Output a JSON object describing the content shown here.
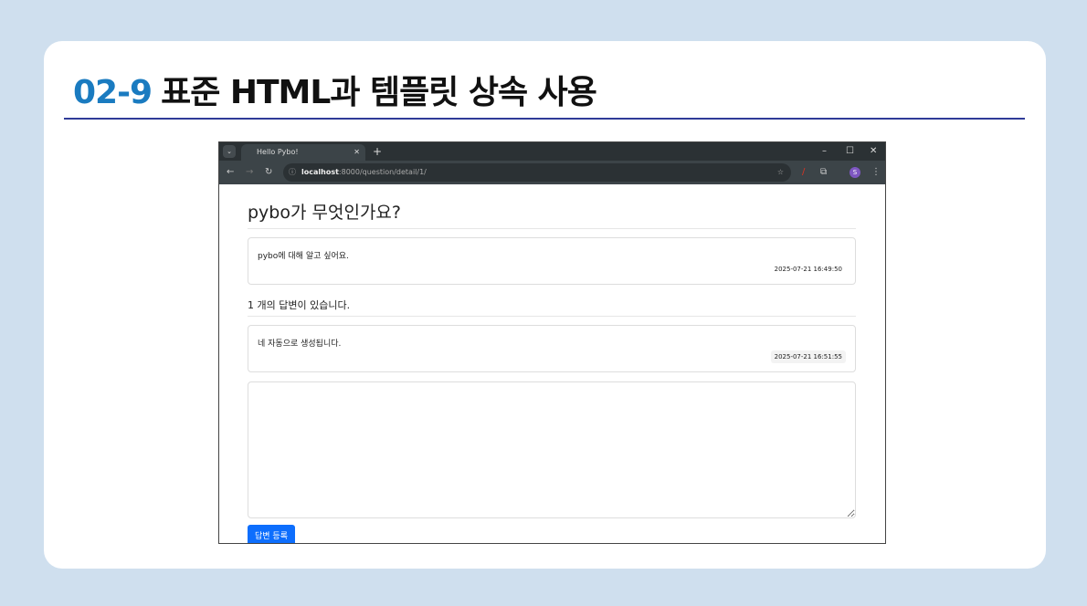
{
  "slide": {
    "number": "02-9",
    "title": "표준 HTML과 템플릿 상속 사용"
  },
  "browser": {
    "tab_title": "Hello Pybo!",
    "new_tab": "+",
    "url_host": "localhost",
    "url_rest": ":8000/question/detail/1/",
    "profile_initial": "S",
    "accent": "#0d6efd"
  },
  "question": {
    "subject": "pybo가 무엇인가요?",
    "content": "pybo에 대해 알고 싶어요.",
    "date": "2025-07-21 16:49:50"
  },
  "answers": {
    "count_text": "1 개의 답변이 있습니다.",
    "items": [
      {
        "content": "네 자동으로 생성됩니다.",
        "date": "2025-07-21 16:51:55"
      }
    ]
  },
  "form": {
    "submit_label": "답변 등록",
    "content_value": ""
  }
}
